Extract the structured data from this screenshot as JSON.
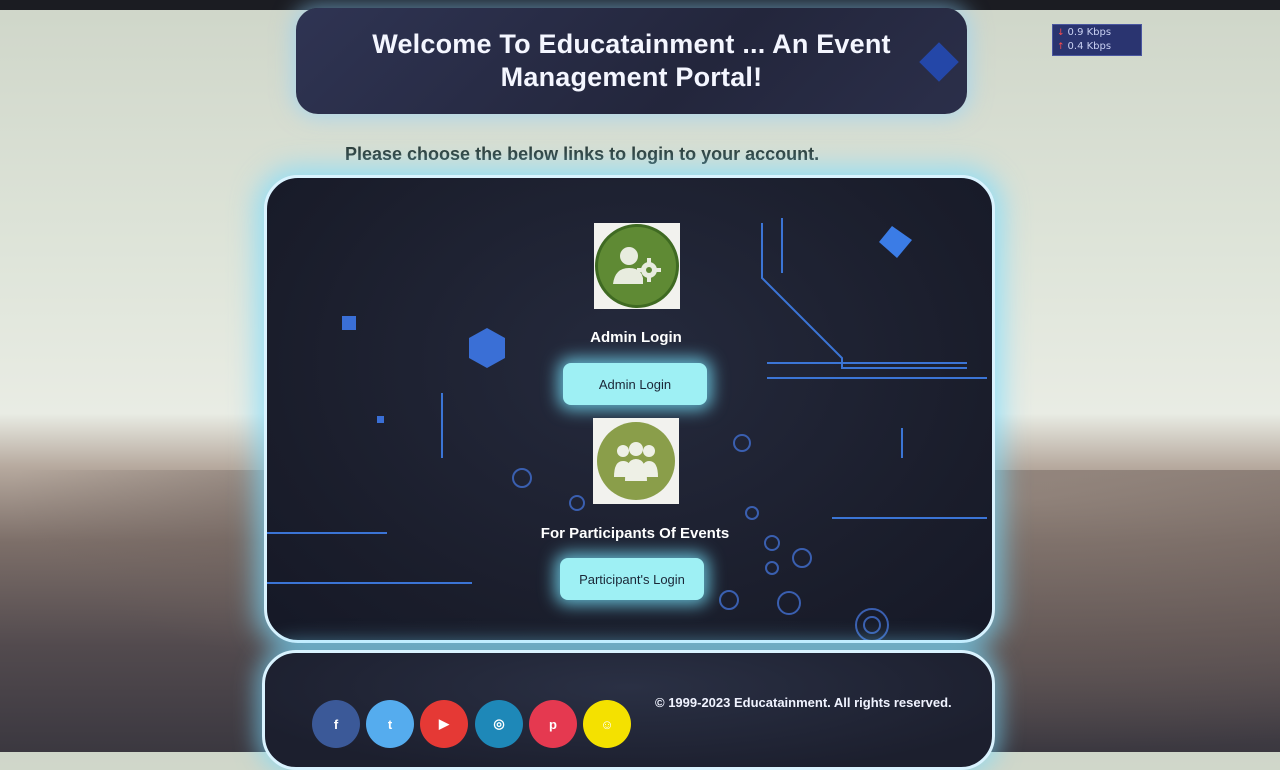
{
  "header": {
    "title": "Welcome To Educatainment ... An Event Management Portal!"
  },
  "subtitle": "Please choose the below links to login to your account.",
  "network_monitor": {
    "download": "0.9 Kbps",
    "upload": "0.4 Kbps"
  },
  "admin": {
    "label": "Admin Login",
    "button_label": "Admin Login",
    "icon": "admin-gear-icon"
  },
  "participant": {
    "label": "For Participants Of Events",
    "button_label": "Participant's Login",
    "icon": "group-icon"
  },
  "footer": {
    "copyright": "© 1999-2023 Educatainment. All rights reserved.",
    "social": [
      {
        "name": "facebook",
        "glyph": "f",
        "color": "#3b5998"
      },
      {
        "name": "twitter",
        "glyph": "t",
        "color": "#55acee"
      },
      {
        "name": "youtube",
        "glyph": "▶",
        "color": "#e53935"
      },
      {
        "name": "instagram",
        "glyph": "◎",
        "color": "#1e88b8"
      },
      {
        "name": "pinterest",
        "glyph": "p",
        "color": "#e53950"
      },
      {
        "name": "snapchat",
        "glyph": "☺",
        "color": "#f4e100"
      }
    ]
  },
  "colors": {
    "accent_glow": "#78dcff",
    "button_bg": "#9ef0f4",
    "panel_bg": "#1a1d2b",
    "admin_icon_green": "#5f8a34"
  }
}
